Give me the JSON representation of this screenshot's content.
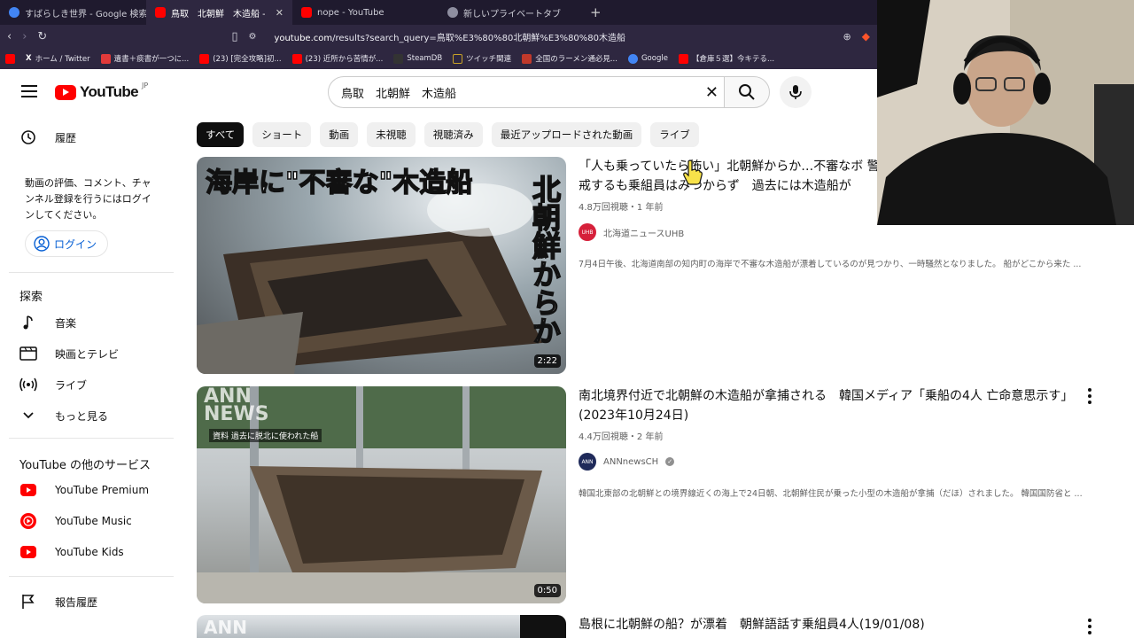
{
  "browser": {
    "tabs": [
      {
        "label": "すばらしき世界 - Google 検索",
        "active": false,
        "color": "#4285f4"
      },
      {
        "label": "鳥取　北朝鮮　木造船 - YouTube",
        "active": true,
        "color": "#ff0000"
      },
      {
        "label": "nope - YouTube",
        "active": false,
        "color": "#ff0000"
      },
      {
        "label": "新しいプライベートタブ",
        "active": false,
        "color": "#8e8ea0"
      }
    ],
    "url_host": "youtube.com",
    "url_path": "/results?search_query=鳥取%E3%80%80北朝鮮%E3%80%80木造船",
    "bookmarks": [
      {
        "label": "",
        "color": "#ff0000"
      },
      {
        "label": "ホーム / Twitter",
        "color": "#111111"
      },
      {
        "label": "遺書＋痰書が一つに...",
        "color": "#e23a3a"
      },
      {
        "label": "(23) [完全攻略]初...",
        "color": "#ff0000"
      },
      {
        "label": "(23) 近所から苦情が...",
        "color": "#ff0000"
      },
      {
        "label": "SteamDB",
        "color": "#333333"
      },
      {
        "label": "ツイッチ関連",
        "color": "#c9a227"
      },
      {
        "label": "全国のラーメン通必見...",
        "color": "#c0392b"
      },
      {
        "label": "Google",
        "color": "#4285f4"
      },
      {
        "label": "【倉庫５選】今キテる...",
        "color": "#ff0000"
      }
    ]
  },
  "youtube": {
    "logo_word": "YouTube",
    "logo_region": "JP",
    "search_value": "鳥取　北朝鮮　木造船"
  },
  "sidebar": {
    "history": "履歴",
    "login_note": "動画の評価、コメント、チャンネル登録を行うにはログインしてください。",
    "login": "ログイン",
    "explore_heading": "探索",
    "explore_items": [
      {
        "label": "音楽",
        "icon": "music-note-icon"
      },
      {
        "label": "映画とテレビ",
        "icon": "film-icon"
      },
      {
        "label": "ライブ",
        "icon": "live-icon"
      },
      {
        "label": "もっと見る",
        "icon": "chevron-down-icon"
      }
    ],
    "services_heading": "YouTube の他のサービス",
    "services": [
      {
        "label": "YouTube Premium"
      },
      {
        "label": "YouTube Music"
      },
      {
        "label": "YouTube Kids"
      }
    ],
    "report_history": "報告履歴"
  },
  "chips": [
    "すべて",
    "ショート",
    "動画",
    "未視聴",
    "視聴済み",
    "最近アップロードされた動画",
    "ライブ"
  ],
  "results": [
    {
      "title": "「人も乗っていたら怖い」北朝鮮からか…不審なボ 警戒するも乗組員はみつからず　過去には木造船が",
      "meta": "4.8万回視聴・1 年前",
      "channel": "北海道ニュースUHB",
      "verified": false,
      "description": "7月4日午後、北海道南部の知内町の海岸で不審な木造船が漂着しているのが見つかり、一時騒然となりました。 船がどこから来た ...",
      "duration": "2:22",
      "thumb_caption": "海岸に\"不審な\"木造船",
      "thumb_side_caption": "北朝鮮からか"
    },
    {
      "title": "南北境界付近で北朝鮮の木造船が拿捕される　韓国メディア「乗船の4人 亡命意思示す」(2023年10月24日)",
      "meta": "4.4万回視聴・2 年前",
      "channel": "ANNnewsCH",
      "verified": true,
      "description": "韓国北東部の北朝鮮との境界線近くの海上で24日朝、北朝鮮住民が乗った小型の木造船が拿捕（だほ）されました。 韓国国防省と ...",
      "duration": "0:50",
      "thumb_caption": "資料 過去に脱北に使われた船",
      "thumb_logo": "ANN NEWS"
    },
    {
      "title": "島根に北朝鮮の船？が漂着　朝鮮語話す乗組員4人(19/01/08)",
      "thumb_logo": "ANN"
    }
  ]
}
